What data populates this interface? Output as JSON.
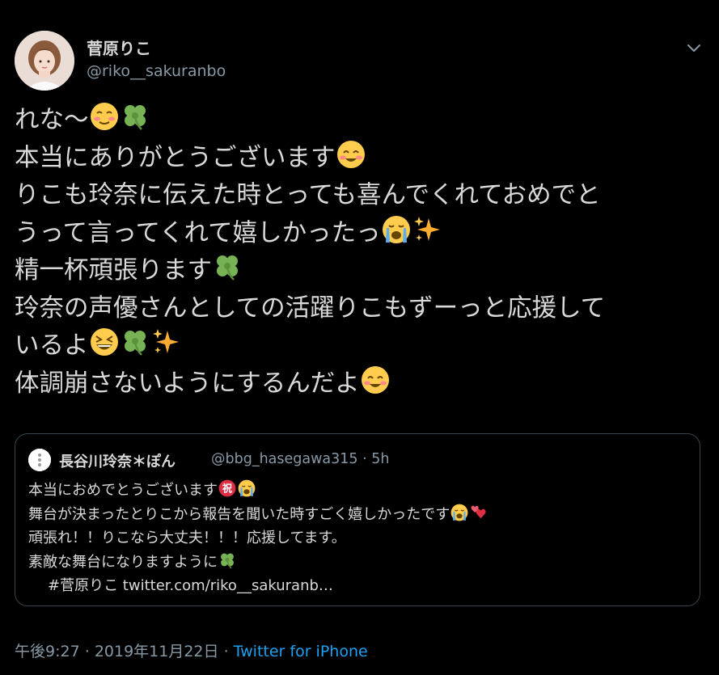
{
  "author": {
    "display_name": "菅原りこ",
    "handle": "@riko__sakuranbo"
  },
  "tweet": {
    "lines": [
      {
        "text": "れな〜",
        "emoji": [
          "blushing-smile-emoji",
          "four-leaf-clover-emoji"
        ]
      },
      {
        "text": "本当にありがとうございます",
        "emoji": [
          "smiling-eyes-emoji"
        ]
      },
      {
        "text": "りこも玲奈に伝えた時とっても喜んでくれておめでと",
        "emoji": []
      },
      {
        "text": "うって言ってくれて嬉しかったっ",
        "emoji": [
          "crying-face-emoji",
          "sparkles-emoji"
        ]
      },
      {
        "text": "精一杯頑張ります",
        "emoji": [
          "four-leaf-clover-emoji"
        ]
      },
      {
        "text": "玲奈の声優さんとしての活躍りこもずーっと応援して",
        "emoji": []
      },
      {
        "text": "いるよ",
        "emoji": [
          "grinning-squinting-emoji",
          "four-leaf-clover-emoji",
          "sparkles-emoji"
        ]
      },
      {
        "text": "体調崩さないようにするんだよ",
        "emoji": [
          "smiling-eyes-emoji"
        ]
      }
    ]
  },
  "quoted_tweet": {
    "display_name": "長谷川玲奈＊ぽん",
    "handle": "@bbg_hasegawa315",
    "separator": "·",
    "time": "5h",
    "lines": [
      {
        "text": "本当におめでとうございます",
        "emoji": [
          "congratulations-emoji",
          "crying-face-emoji"
        ]
      },
      {
        "text": "舞台が決まったとりこから報告を聞いた時すごく嬉しかったです",
        "emoji": [
          "crying-face-emoji",
          "two-hearts-emoji"
        ]
      },
      {
        "text": "頑張れ！！りこなら大丈夫！！！応援してます。",
        "emoji": []
      },
      {
        "text": "素敵な舞台になりますように",
        "emoji": [
          "four-leaf-clover-emoji"
        ]
      }
    ],
    "link_line": "#菅原りこ twitter.com/riko__sakuranb…"
  },
  "footer": {
    "time": "午後9:27",
    "separator1": "·",
    "date": "2019年11月22日",
    "separator2": "·",
    "source": "Twitter for iPhone"
  },
  "icons": {
    "caret": "chevron-down-icon"
  },
  "colors": {
    "background": "#000000",
    "text": "#d9d9d9",
    "secondary": "#8899a6",
    "link": "#1da1f2",
    "border": "#38444d"
  }
}
